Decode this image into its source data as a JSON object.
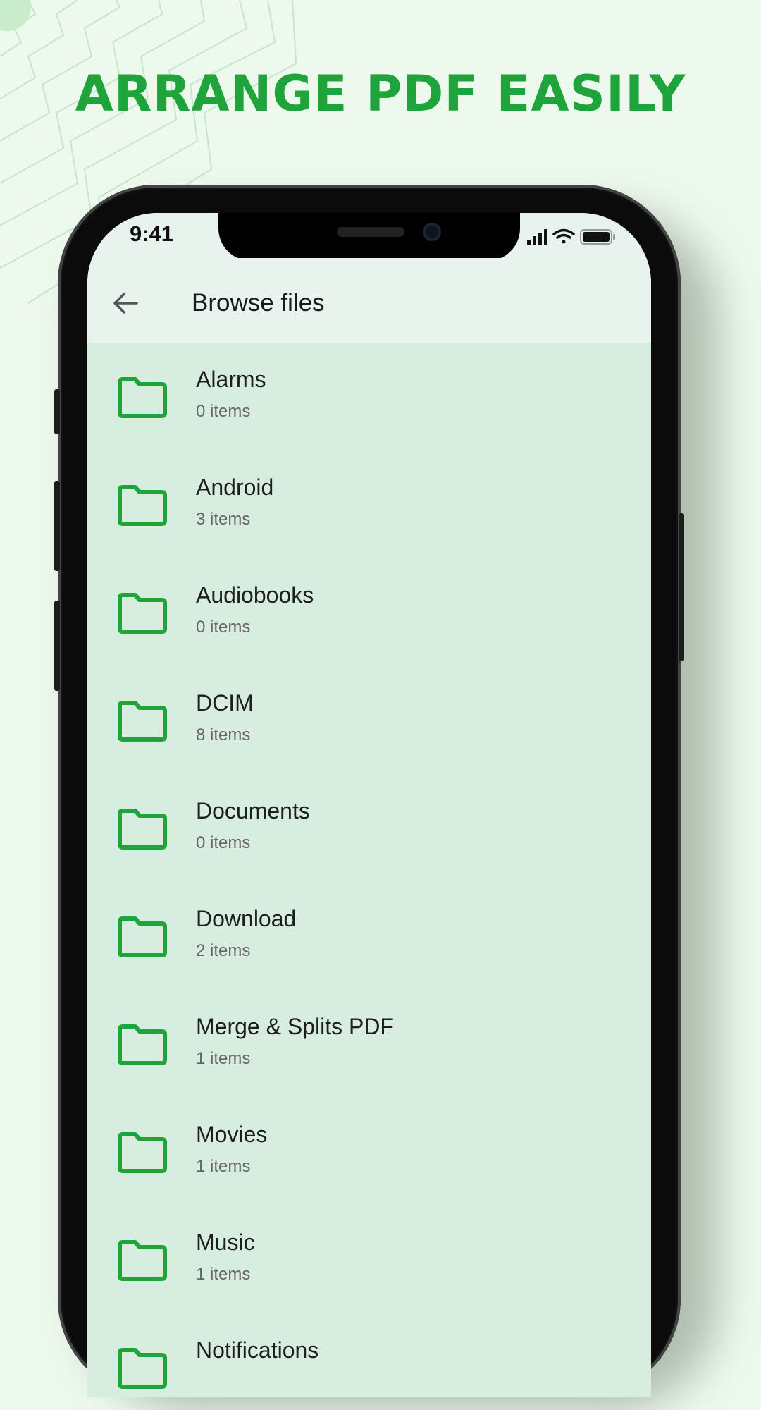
{
  "headline": "ARRANGE PDF EASILY",
  "colors": {
    "accent": "#1fa33b",
    "background": "#eef9ee",
    "screen": "#d6ede0",
    "app_bar": "#e8f3ee"
  },
  "status_bar": {
    "time": "9:41",
    "icons": [
      "signal-icon",
      "wifi-icon",
      "battery-icon"
    ]
  },
  "app_bar": {
    "back_icon": "arrow-left-icon",
    "title": "Browse files"
  },
  "folders": [
    {
      "name": "Alarms",
      "count": "0 items"
    },
    {
      "name": "Android",
      "count": "3 items"
    },
    {
      "name": "Audiobooks",
      "count": "0 items"
    },
    {
      "name": "DCIM",
      "count": "8 items"
    },
    {
      "name": "Documents",
      "count": "0 items"
    },
    {
      "name": "Download",
      "count": "2 items"
    },
    {
      "name": "Merge & Splits PDF",
      "count": "1 items"
    },
    {
      "name": "Movies",
      "count": "1 items"
    },
    {
      "name": "Music",
      "count": "1 items"
    },
    {
      "name": "Notifications",
      "count": ""
    }
  ]
}
